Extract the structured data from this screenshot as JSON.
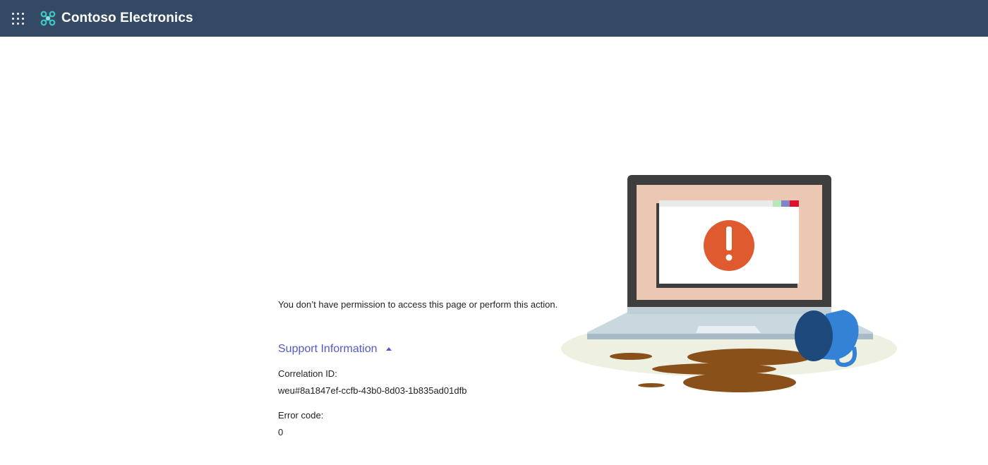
{
  "header": {
    "app_name": "Contoso Electronics",
    "background_color": "#344a64",
    "apps_icon": "waffle-grid-icon",
    "logo_icon": "contoso-logo-icon"
  },
  "error": {
    "message": "You don’t have permission to access this page or perform this action.",
    "support_toggle_label": "Support Information",
    "support_toggle_color": "#5558c8",
    "correlation_id_label": "Correlation ID:",
    "correlation_id_value": "weu#8a1847ef-ccfb-43b0-8d03-1b835ad01dfb",
    "error_code_label": "Error code:",
    "error_code_value": "0"
  },
  "illustration": {
    "name": "broken-laptop-spilled-coffee-illustration",
    "alert_color": "#e05a30"
  }
}
